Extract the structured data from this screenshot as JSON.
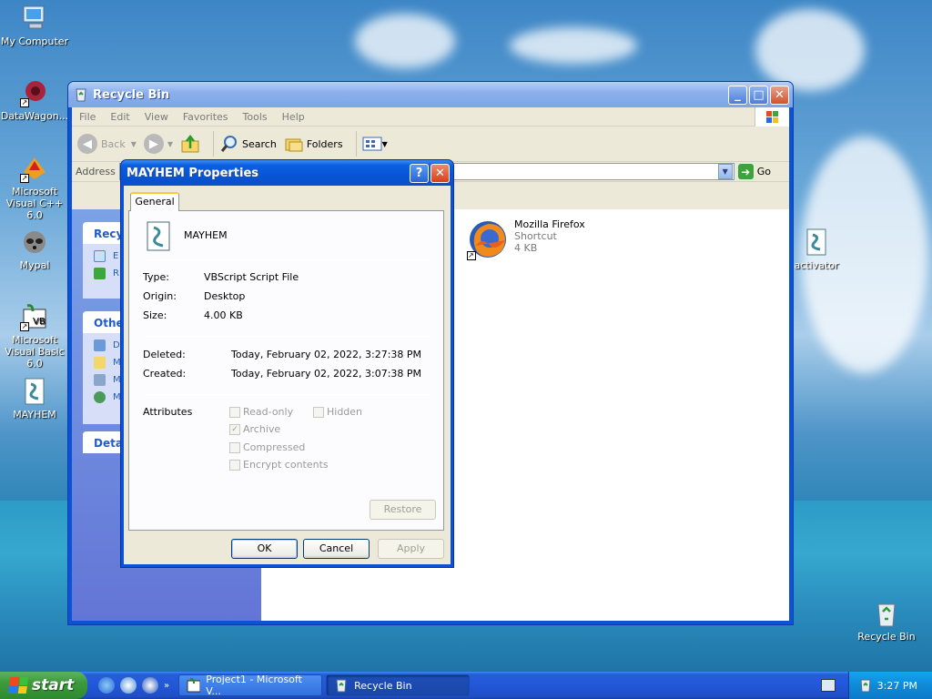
{
  "desktop": {
    "icons": [
      {
        "label": "My Computer"
      },
      {
        "label": "DataWagon..."
      },
      {
        "label": "Microsoft Visual C++ 6.0"
      },
      {
        "label": "Mypal"
      },
      {
        "label": "Microsoft Visual Basic 6.0"
      },
      {
        "label": "MAYHEM"
      },
      {
        "label": "activator"
      },
      {
        "label": "Recycle Bin"
      }
    ]
  },
  "explorer": {
    "title": "Recycle Bin",
    "menu": [
      "File",
      "Edit",
      "View",
      "Favorites",
      "Tools",
      "Help"
    ],
    "toolbar": {
      "back": "Back",
      "search": "Search",
      "folders": "Folders"
    },
    "address_label": "Address",
    "go_label": "Go",
    "taskpane": {
      "box1_header": "Recyc",
      "box1_items": [
        "E",
        "R"
      ],
      "box2_header": "Othe",
      "box2_items": [
        "D",
        "M",
        "M",
        "M"
      ],
      "box3_header": "Detai"
    },
    "file": {
      "name": "Mozilla Firefox",
      "type": "Shortcut",
      "size": "4 KB"
    }
  },
  "dialog": {
    "title": "MAYHEM Properties",
    "tab": "General",
    "file_name": "MAYHEM",
    "type_label": "Type:",
    "type_value": "VBScript Script File",
    "origin_label": "Origin:",
    "origin_value": "Desktop",
    "size_label": "Size:",
    "size_value": "4.00 KB",
    "deleted_label": "Deleted:",
    "deleted_value": "Today, February 02, 2022, 3:27:38 PM",
    "created_label": "Created:",
    "created_value": "Today, February 02, 2022, 3:07:38 PM",
    "attributes_label": "Attributes",
    "attr_readonly": "Read-only",
    "attr_hidden": "Hidden",
    "attr_archive": "Archive",
    "attr_compressed": "Compressed",
    "attr_encrypt": "Encrypt contents",
    "restore": "Restore",
    "ok": "OK",
    "cancel": "Cancel",
    "apply": "Apply"
  },
  "taskbar": {
    "start": "start",
    "tasks": [
      "Project1 - Microsoft V...",
      "Recycle Bin"
    ],
    "clock": "3:27 PM"
  }
}
